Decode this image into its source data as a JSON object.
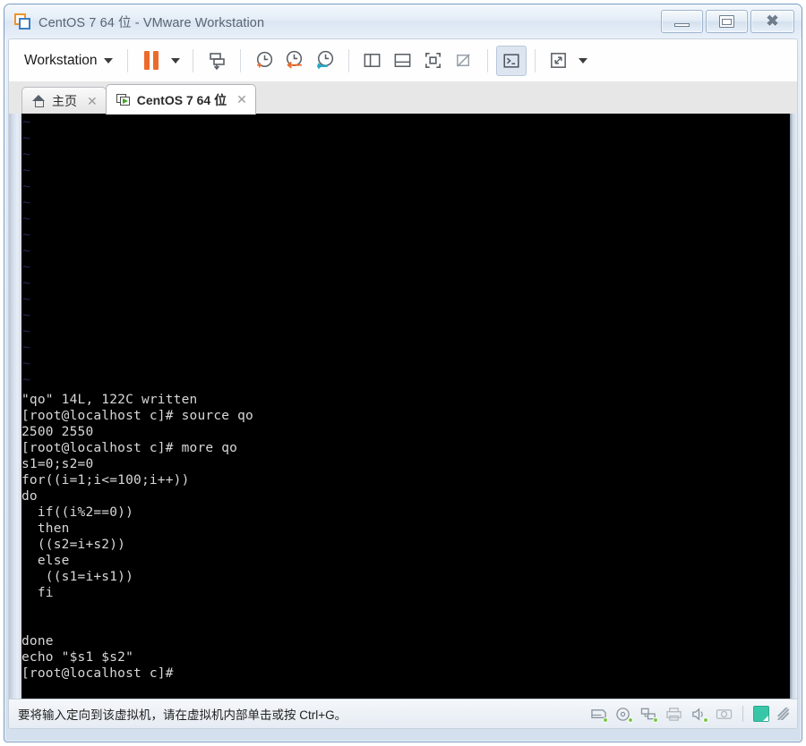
{
  "window": {
    "title": "CentOS 7 64 位 - VMware Workstation",
    "logo_icon": "vmware-logo-icon",
    "minimize_label": "最小化",
    "restore_label": "还原",
    "close_label": "关闭",
    "close_glyph": "✖"
  },
  "toolbar": {
    "workstation_label": "Workstation",
    "workstation_caret": "chevron-down-icon",
    "items": [
      {
        "name": "pause-vm-button",
        "icon": "pause-icon",
        "label": "暂停"
      },
      {
        "name": "pause-dropdown-button",
        "icon": "chevron-down-icon",
        "label": "暂停选项"
      },
      {
        "name": "send-ctrl-alt-del-button",
        "icon": "send-key-icon",
        "label": "发送组合键"
      },
      {
        "name": "take-snapshot-button",
        "icon": "snapshot-add-clock-icon",
        "label": "拍摄快照"
      },
      {
        "name": "revert-snapshot-button",
        "icon": "snapshot-revert-clock-icon",
        "label": "恢复快照"
      },
      {
        "name": "snapshot-manager-button",
        "icon": "snapshot-manager-clock-icon",
        "label": "快照管理器"
      },
      {
        "name": "show-library-button",
        "icon": "panel-left-icon",
        "label": "显示库"
      },
      {
        "name": "show-thumbnail-bar-button",
        "icon": "panel-bottom-icon",
        "label": "缩略图栏"
      },
      {
        "name": "enter-fullscreen-button",
        "icon": "fullscreen-icon",
        "label": "全屏"
      },
      {
        "name": "unity-mode-button",
        "icon": "unity-disabled-icon",
        "label": "Unity 模式"
      },
      {
        "name": "console-view-button",
        "icon": "console-prompt-icon",
        "label": "控制台视图",
        "active": true
      },
      {
        "name": "stretch-view-button",
        "icon": "expand-arrows-icon",
        "label": "拉伸视图"
      },
      {
        "name": "stretch-dropdown-button",
        "icon": "chevron-down-icon",
        "label": "视图选项"
      }
    ]
  },
  "tabs": [
    {
      "label": "主页",
      "icon": "home-icon",
      "close": "✕",
      "active": false
    },
    {
      "label": "CentOS 7 64 位",
      "icon": "vm-running-icon",
      "close": "✕",
      "active": true
    }
  ],
  "vm_screen": {
    "tilde_marker": "~",
    "tilde_count": 17,
    "terminal_lines": [
      "\"qo\" 14L, 122C written",
      "[root@localhost c]# source qo",
      "2500 2550",
      "[root@localhost c]# more qo",
      "s1=0;s2=0",
      "for((i=1;i<=100;i++))",
      "do",
      "  if((i%2==0))",
      "  then",
      "  ((s2=i+s2))",
      "  else",
      "   ((s1=i+s1))",
      "  fi",
      "",
      "",
      "done",
      "echo \"$s1 $s2\"",
      "[root@localhost c]#"
    ]
  },
  "status_bar": {
    "message": "要将输入定向到该虚拟机，请在虚拟机内部单击或按 Ctrl+G。",
    "icons": [
      {
        "name": "hard-disk-icon",
        "label": "硬盘"
      },
      {
        "name": "cd-dvd-icon",
        "label": "CD/DVD"
      },
      {
        "name": "network-adapter-icon",
        "label": "网络适配器"
      },
      {
        "name": "printer-icon",
        "label": "打印机"
      },
      {
        "name": "sound-card-icon",
        "label": "声卡"
      },
      {
        "name": "camera-icon",
        "label": "摄像头"
      }
    ],
    "note_icon": "note-icon",
    "grip_icon": "resize-grip-icon"
  },
  "colors": {
    "accent_orange": "#ec6a2c",
    "accent_teal": "#38c6a8",
    "logo_blue": "#3b7fc4",
    "terminal_bg": "#000000",
    "terminal_fg": "#d8d8d8",
    "tilde": "#2a1f52",
    "status_dot": "#7ac943"
  }
}
